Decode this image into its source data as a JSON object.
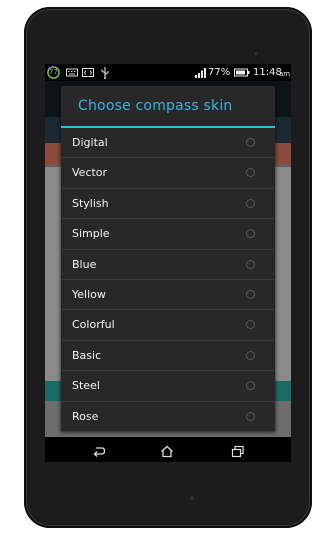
{
  "status_bar": {
    "notification_icons": [
      "app-77-icon",
      "keyboard-icon",
      "code-icon",
      "usb-icon"
    ],
    "notification_badge": "77",
    "signal_icon": "signal-icon",
    "battery_percent": "77%",
    "battery_icon": "battery-icon",
    "time": "11:48",
    "ampm": "am"
  },
  "dialog": {
    "title": "Choose compass skin",
    "options": [
      {
        "label": "Digital",
        "selected": false
      },
      {
        "label": "Vector",
        "selected": false
      },
      {
        "label": "Stylish",
        "selected": false
      },
      {
        "label": "Simple",
        "selected": false
      },
      {
        "label": "Blue",
        "selected": false
      },
      {
        "label": "Yellow",
        "selected": false
      },
      {
        "label": "Colorful",
        "selected": false
      },
      {
        "label": "Basic",
        "selected": false
      },
      {
        "label": "Steel",
        "selected": false
      },
      {
        "label": "Rose",
        "selected": false
      }
    ]
  },
  "nav_bar": {
    "back_icon": "back-icon",
    "home_icon": "home-icon",
    "recents_icon": "recents-icon"
  },
  "colors": {
    "accent": "#33b5e5",
    "dialog_bg": "#282828",
    "text": "#f4f4f4"
  }
}
